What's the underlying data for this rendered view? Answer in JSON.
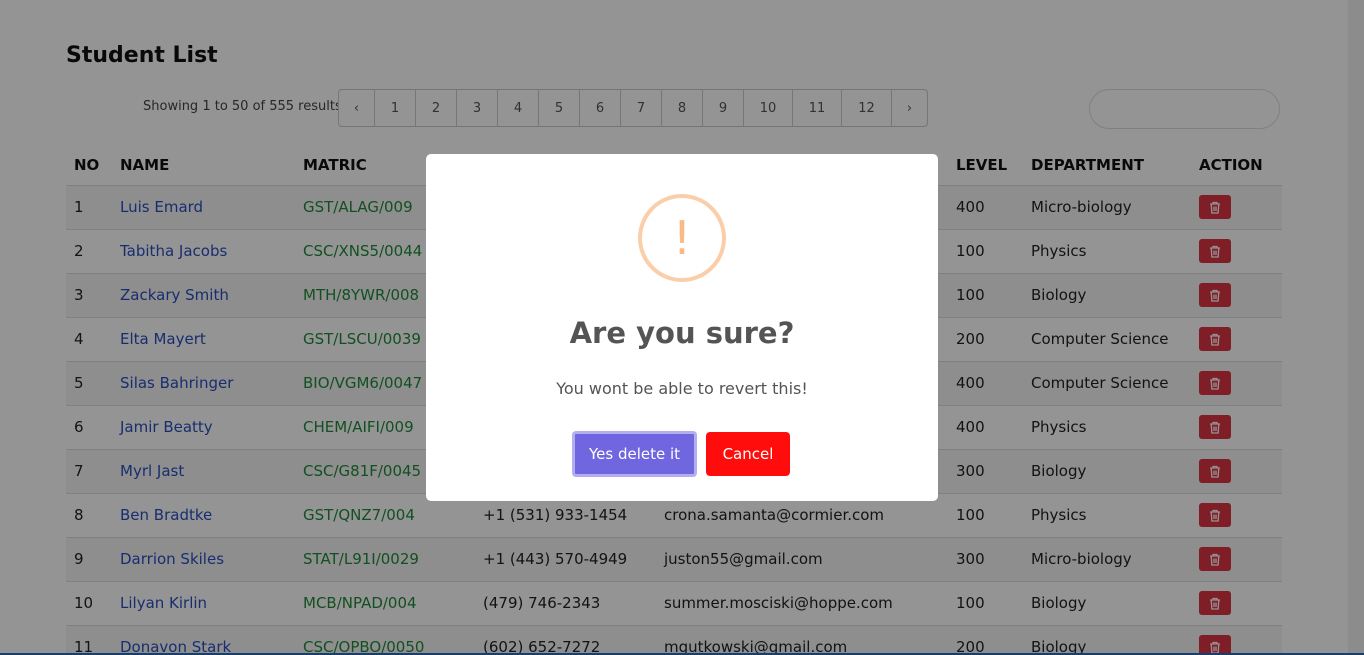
{
  "page": {
    "title": "Student List"
  },
  "pagination": {
    "summary": "Showing 1 to 50 of 555 results",
    "prev_label": "‹",
    "next_label": "›",
    "pages": [
      "1",
      "2",
      "3",
      "4",
      "5",
      "6",
      "7",
      "8",
      "9",
      "10",
      "11",
      "12"
    ]
  },
  "search": {
    "placeholder": ""
  },
  "table": {
    "headers": {
      "no": "NO",
      "name": "NAME",
      "matric": "MATRIC",
      "level": "LEVEL",
      "department": "DEPARTMENT",
      "action": "ACTION"
    },
    "rows": [
      {
        "no": "1",
        "name": "Luis Emard",
        "matric": "GST/ALAG/009",
        "phone": "",
        "email": "",
        "level": "400",
        "department": "Micro-biology"
      },
      {
        "no": "2",
        "name": "Tabitha Jacobs",
        "matric": "CSC/XNS5/0044",
        "phone": "",
        "email": "",
        "level": "100",
        "department": "Physics"
      },
      {
        "no": "3",
        "name": "Zackary Smith",
        "matric": "MTH/8YWR/008",
        "phone": "",
        "email": "",
        "level": "100",
        "department": "Biology"
      },
      {
        "no": "4",
        "name": "Elta Mayert",
        "matric": "GST/LSCU/0039",
        "phone": "",
        "email": "",
        "level": "200",
        "department": "Computer Science"
      },
      {
        "no": "5",
        "name": "Silas Bahringer",
        "matric": "BIO/VGM6/0047",
        "phone": "",
        "email": "",
        "level": "400",
        "department": "Computer Science"
      },
      {
        "no": "6",
        "name": "Jamir Beatty",
        "matric": "CHEM/AIFI/009",
        "phone": "",
        "email": "",
        "level": "400",
        "department": "Physics"
      },
      {
        "no": "7",
        "name": "Myrl Jast",
        "matric": "CSC/G81F/0045",
        "phone": "",
        "email": "",
        "level": "300",
        "department": "Biology"
      },
      {
        "no": "8",
        "name": "Ben Bradtke",
        "matric": "GST/QNZ7/004",
        "phone": "+1 (531) 933-1454",
        "email": "crona.samanta@cormier.com",
        "level": "100",
        "department": "Physics"
      },
      {
        "no": "9",
        "name": "Darrion Skiles",
        "matric": "STAT/L91I/0029",
        "phone": "+1 (443) 570-4949",
        "email": "juston55@gmail.com",
        "level": "300",
        "department": "Micro-biology"
      },
      {
        "no": "10",
        "name": "Lilyan Kirlin",
        "matric": "MCB/NPAD/004",
        "phone": "(479) 746-2343",
        "email": "summer.mosciski@hoppe.com",
        "level": "100",
        "department": "Biology"
      },
      {
        "no": "11",
        "name": "Donavon Stark",
        "matric": "CSC/OPBO/0050",
        "phone": "(602) 652-7272",
        "email": "mgutkowski@gmail.com",
        "level": "200",
        "department": "Biology"
      }
    ]
  },
  "modal": {
    "icon_glyph": "!",
    "title": "Are you sure?",
    "text": "You wont be able to revert this!",
    "confirm_label": "Yes delete it",
    "cancel_label": "Cancel"
  },
  "colors": {
    "accent": "#7066e0",
    "danger": "#ff0d0d",
    "delete_button": "#dc3545",
    "name_link": "#2a4fbf",
    "matric": "#1f8a3a",
    "warning": "#f8bb86"
  }
}
